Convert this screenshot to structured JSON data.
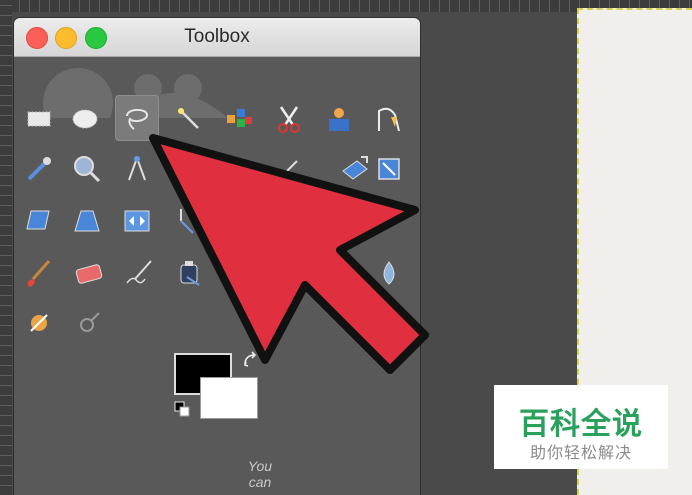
{
  "window": {
    "title": "Toolbox",
    "controls": {
      "close": "close-icon",
      "minimize": "minimize-icon",
      "maximize": "maximize-icon"
    }
  },
  "tools": [
    {
      "name": "rect-select-tool",
      "icon": "rect-select-icon",
      "active": false
    },
    {
      "name": "ellipse-select-tool",
      "icon": "ellipse-select-icon",
      "active": false
    },
    {
      "name": "free-select-tool",
      "icon": "lasso-icon",
      "active": true
    },
    {
      "name": "fuzzy-select-tool",
      "icon": "magic-wand-icon",
      "active": false
    },
    {
      "name": "select-by-color-tool",
      "icon": "color-select-icon",
      "active": false
    },
    {
      "name": "scissors-select-tool",
      "icon": "scissors-icon",
      "active": false
    },
    {
      "name": "foreground-select-tool",
      "icon": "foreground-select-icon",
      "active": false
    },
    {
      "name": "paths-tool",
      "icon": "paths-icon",
      "active": false
    },
    {
      "name": "color-picker-tool",
      "icon": "eyedropper-icon",
      "active": false
    },
    {
      "name": "zoom-tool",
      "icon": "magnifier-icon",
      "active": false
    },
    {
      "name": "measure-tool",
      "icon": "compass-icon",
      "active": false
    },
    {
      "name": "rotate-tool",
      "icon": "rotate-icon",
      "active": false
    },
    {
      "name": "scale-tool",
      "icon": "scale-icon",
      "active": false
    },
    {
      "name": "perspective-tool",
      "icon": "perspective-icon",
      "active": false
    },
    {
      "name": "shear-tool",
      "icon": "shear-icon",
      "active": false
    },
    {
      "name": "flip-tool",
      "icon": "flip-icon",
      "active": false
    },
    {
      "name": "cage-transform-tool",
      "icon": "cage-icon",
      "active": false
    },
    {
      "name": "paintbrush-tool",
      "icon": "paintbrush-icon",
      "active": false
    },
    {
      "name": "eraser-tool",
      "icon": "eraser-icon",
      "active": false
    },
    {
      "name": "airbrush-tool",
      "icon": "airbrush-icon",
      "active": false
    },
    {
      "name": "ink-tool",
      "icon": "ink-icon",
      "active": false
    },
    {
      "name": "blur-tool",
      "icon": "blur-icon",
      "active": false
    },
    {
      "name": "dodge-burn-tool",
      "icon": "dodge-burn-icon",
      "active": false
    },
    {
      "name": "smudge-tool",
      "icon": "smudge-icon",
      "active": false
    }
  ],
  "colors": {
    "foreground": "#000000",
    "background": "#ffffff",
    "arrow": "#e03040"
  },
  "hint_text": "You can",
  "watermark": {
    "title": "百科全说",
    "subtitle": "助你轻松解决"
  }
}
